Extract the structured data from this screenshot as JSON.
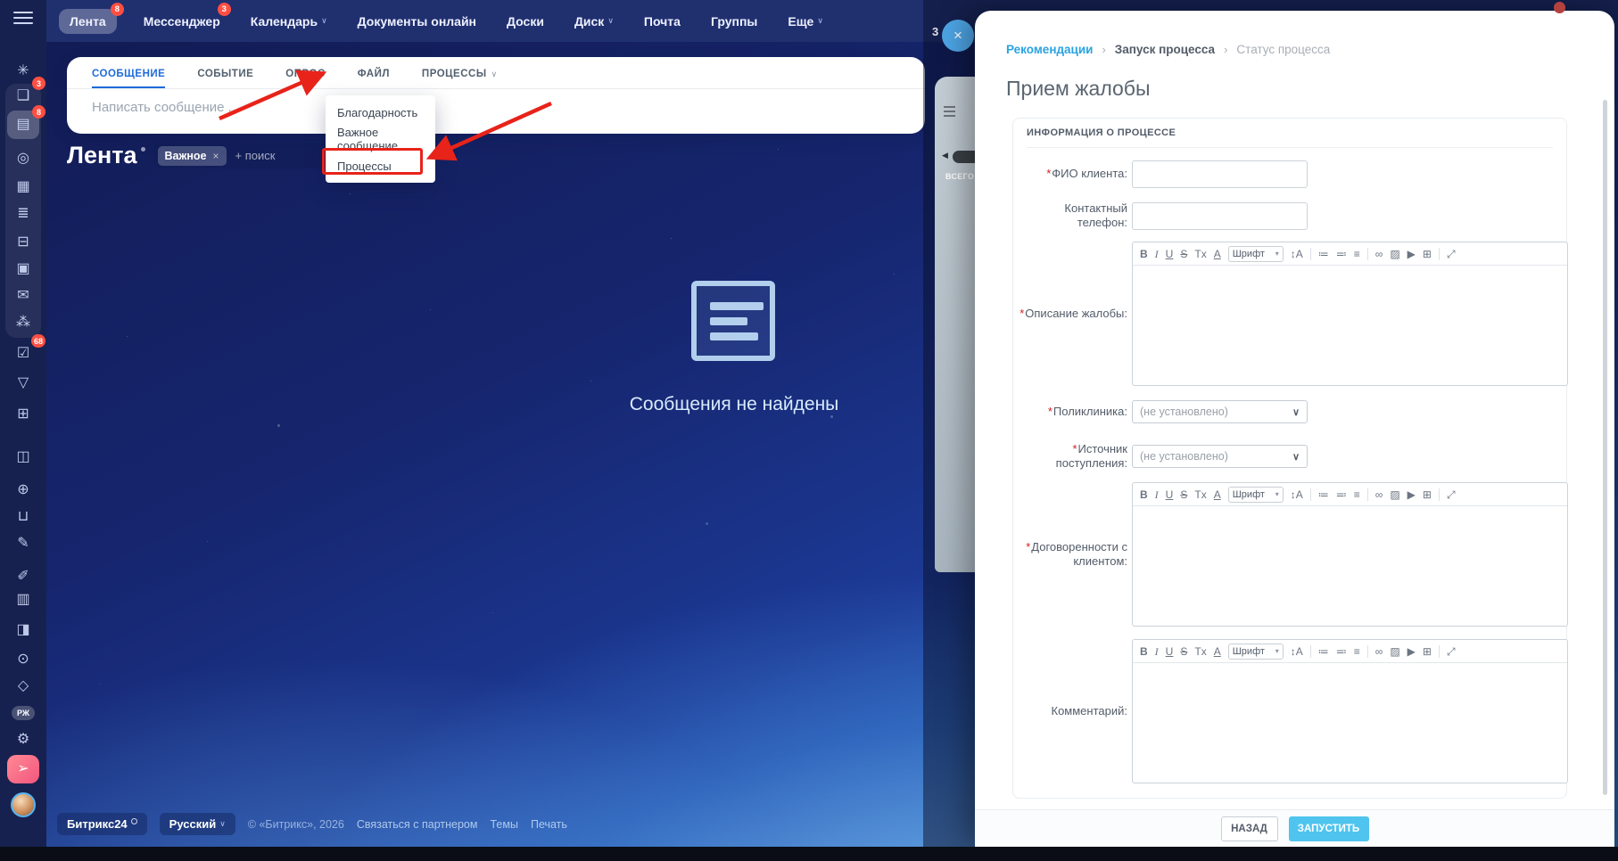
{
  "icons": {
    "caret": "∨",
    "chevron_small": "▾",
    "breadcrumb_sep": "›",
    "close": "×",
    "sliver_arrow": "◀"
  },
  "topnav": {
    "items": [
      {
        "name": "feed",
        "label": "Лента",
        "badge": "8",
        "active": true
      },
      {
        "name": "messenger",
        "label": "Мессенджер",
        "badge": "3"
      },
      {
        "name": "calendar",
        "label": "Календарь",
        "caret": true
      },
      {
        "name": "docs-online",
        "label": "Документы онлайн"
      },
      {
        "name": "boards",
        "label": "Доски"
      },
      {
        "name": "drive",
        "label": "Диск",
        "caret": true
      },
      {
        "name": "mail",
        "label": "Почта"
      },
      {
        "name": "groups",
        "label": "Группы"
      },
      {
        "name": "more",
        "label": "Еще",
        "caret": true
      }
    ]
  },
  "sidebar": {
    "items": [
      {
        "name": "copilot",
        "glyph": "✳"
      },
      {
        "name": "messenger",
        "glyph": "❑",
        "badge": "3"
      },
      {
        "name": "feed",
        "glyph": "▤",
        "badge": "8",
        "active": true
      },
      {
        "name": "automation",
        "glyph": "◎"
      },
      {
        "name": "calendar",
        "glyph": "▦"
      },
      {
        "name": "documents",
        "glyph": "≣"
      },
      {
        "name": "boards",
        "glyph": "⊟"
      },
      {
        "name": "drive",
        "glyph": "▣"
      },
      {
        "name": "mail",
        "glyph": "✉"
      },
      {
        "name": "groups",
        "glyph": "⁂"
      },
      {
        "name": "tasks",
        "glyph": "☑",
        "badge": "68"
      },
      {
        "name": "crm",
        "glyph": "▽"
      },
      {
        "name": "planner",
        "glyph": "⊞"
      },
      {
        "name": "archive",
        "glyph": "◫"
      },
      {
        "name": "goals",
        "glyph": "⊕"
      },
      {
        "name": "shop",
        "glyph": "⊔"
      },
      {
        "name": "sign",
        "glyph": "✎"
      },
      {
        "name": "edit",
        "glyph": "✐"
      },
      {
        "name": "reports",
        "glyph": "▥"
      },
      {
        "name": "contacts",
        "glyph": "◨"
      },
      {
        "name": "ai-bot",
        "glyph": "⊙"
      },
      {
        "name": "apps",
        "glyph": "◇"
      },
      {
        "name": "rz",
        "glyph": "РЖ",
        "chip": true
      },
      {
        "name": "settings",
        "glyph": "⚙"
      },
      {
        "name": "rocket",
        "glyph": "➢",
        "accent": true
      },
      {
        "name": "profile",
        "avatar": true
      }
    ]
  },
  "feed": {
    "tabs": [
      {
        "name": "message",
        "label": "СООБЩЕНИЕ",
        "active": true
      },
      {
        "name": "event",
        "label": "СОБЫТИЕ"
      },
      {
        "name": "poll",
        "label": "ОПРОС"
      },
      {
        "name": "file",
        "label": "ФАЙЛ"
      },
      {
        "name": "processes",
        "label": "ПРОЦЕССЫ",
        "caret": true
      }
    ],
    "composer_placeholder": "Написать сообщение ...",
    "heading": "Лента",
    "filter_chip": "Важное",
    "filter_remove": "×",
    "search_placeholder": "+ поиск",
    "empty_text": "Сообщения не найдены"
  },
  "dropdown": {
    "items": [
      {
        "name": "thanks",
        "label": "Благодарность"
      },
      {
        "name": "important-message",
        "label": "Важное сообщение"
      },
      {
        "name": "processes",
        "label": "Процессы",
        "highlighted": true
      }
    ]
  },
  "footer": {
    "brand": "Битрикс24",
    "language": "Русский",
    "copyright": "© «Битрикс», 2026",
    "links": [
      {
        "name": "contact-partner",
        "label": "Связаться с партнером"
      },
      {
        "name": "themes",
        "label": "Темы"
      },
      {
        "name": "print",
        "label": "Печать"
      }
    ]
  },
  "background_panel": {
    "total_label": "ВСЕГО:",
    "badge": "3"
  },
  "slideover": {
    "breadcrumbs": [
      {
        "label": "Рекомендации"
      },
      {
        "label": "Запуск процесса"
      },
      {
        "label": "Статус процесса"
      }
    ],
    "title": "Прием жалобы",
    "form": {
      "section_title": "ИНФОРМАЦИЯ О ПРОЦЕССЕ",
      "required_mark": "*",
      "fields": {
        "fio": "ФИО клиента:",
        "phone": "Контактный телефон:",
        "description": "Описание жалобы:",
        "clinic": "Поликлиника:",
        "source": "Источник поступления:",
        "agreement": "Договоренности с клиентом:",
        "comment": "Комментарий:"
      },
      "select_value": "(не установлено)",
      "buttons": {
        "back": "НАЗАД",
        "start": "ЗАПУСТИТЬ"
      }
    },
    "editor_toolbar": {
      "font_label": "Шрифт",
      "items": [
        {
          "name": "bold",
          "glyph": "B"
        },
        {
          "name": "italic",
          "glyph": "I"
        },
        {
          "name": "underline",
          "glyph": "U"
        },
        {
          "name": "strikethrough",
          "glyph": "S"
        },
        {
          "name": "clear-format",
          "glyph": "Tx"
        },
        {
          "name": "text-color",
          "glyph": "A"
        },
        {
          "name": "font-select",
          "glyph": "Шрифт",
          "type": "select"
        },
        {
          "name": "font-size",
          "glyph": "↕A"
        },
        {
          "name": "sep"
        },
        {
          "name": "ordered-list",
          "glyph": "≔"
        },
        {
          "name": "bullet-list",
          "glyph": "≕"
        },
        {
          "name": "align",
          "glyph": "≡"
        },
        {
          "name": "sep"
        },
        {
          "name": "link",
          "glyph": "∞"
        },
        {
          "name": "image",
          "glyph": "▨"
        },
        {
          "name": "video",
          "glyph": "▶"
        },
        {
          "name": "table",
          "glyph": "⊞"
        },
        {
          "name": "sep"
        },
        {
          "name": "expand",
          "glyph": "⤢"
        }
      ]
    }
  },
  "colors": {
    "accent_blue": "#1f6bd9",
    "link_blue": "#29a3e1",
    "start_button": "#4fc4ee",
    "annotation_red": "#e8231a",
    "badge_red": "#ff4f42"
  }
}
